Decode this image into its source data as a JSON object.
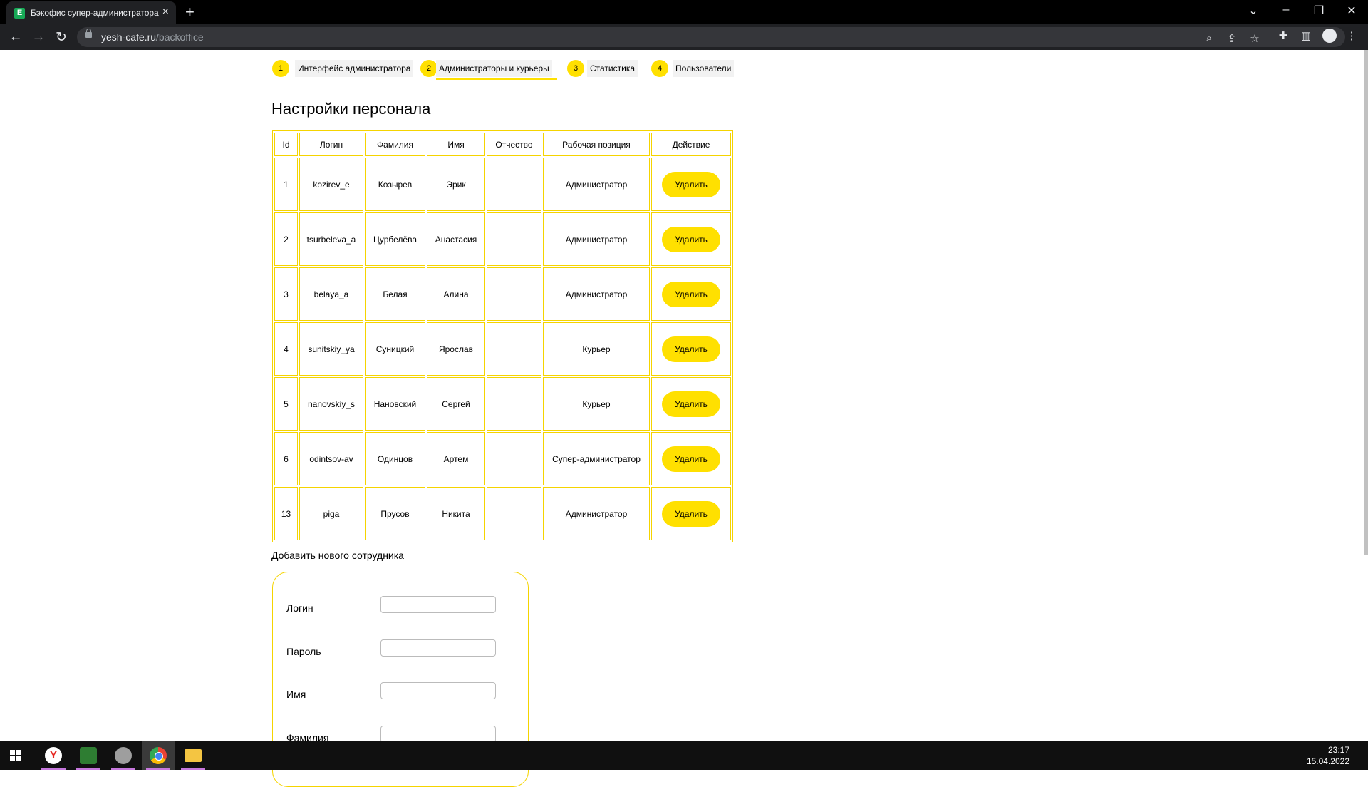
{
  "browser": {
    "tab_title": "Бэкофис супер-администратора",
    "url_domain": "yesh-cafe.ru",
    "url_path": "/backoffice"
  },
  "steps": [
    {
      "num": "1",
      "label": "Интерфейс администратора"
    },
    {
      "num": "2",
      "label": "Администраторы и курьеры"
    },
    {
      "num": "3",
      "label": "Статистика"
    },
    {
      "num": "4",
      "label": "Пользователи"
    }
  ],
  "page_title": "Настройки персонала",
  "table": {
    "headers": [
      "Id",
      "Логин",
      "Фамилия",
      "Имя",
      "Отчество",
      "Рабочая позиция",
      "Действие"
    ],
    "delete_label": "Удалить",
    "rows": [
      {
        "id": "1",
        "login": "kozirev_e",
        "surname": "Козырев",
        "name": "Эрик",
        "patronymic": "",
        "position": "Администратор"
      },
      {
        "id": "2",
        "login": "tsurbeleva_a",
        "surname": "Цурбелёва",
        "name": "Анастасия",
        "patronymic": "",
        "position": "Администратор"
      },
      {
        "id": "3",
        "login": "belaya_a",
        "surname": "Белая",
        "name": "Алина",
        "patronymic": "",
        "position": "Администратор"
      },
      {
        "id": "4",
        "login": "sunitskiy_ya",
        "surname": "Суницкий",
        "name": "Ярослав",
        "patronymic": "",
        "position": "Курьер"
      },
      {
        "id": "5",
        "login": "nanovskiy_s",
        "surname": "Нановский",
        "name": "Сергей",
        "patronymic": "",
        "position": "Курьер"
      },
      {
        "id": "6",
        "login": "odintsov-av",
        "surname": "Одинцов",
        "name": "Артем",
        "patronymic": "",
        "position": "Супер-администратор"
      },
      {
        "id": "13",
        "login": "piga",
        "surname": "Прусов",
        "name": "Никита",
        "patronymic": "",
        "position": "Администратор"
      }
    ]
  },
  "add_form": {
    "title": "Добавить нового сотрудника",
    "fields": [
      {
        "label": "Логин",
        "value": ""
      },
      {
        "label": "Пароль",
        "value": ""
      },
      {
        "label": "Имя",
        "value": ""
      },
      {
        "label": "Фамилия",
        "value": ""
      }
    ]
  },
  "taskbar": {
    "time": "23:17",
    "date": "15.04.2022"
  },
  "colors": {
    "accent": "#ffe000",
    "border": "#f5d400"
  }
}
